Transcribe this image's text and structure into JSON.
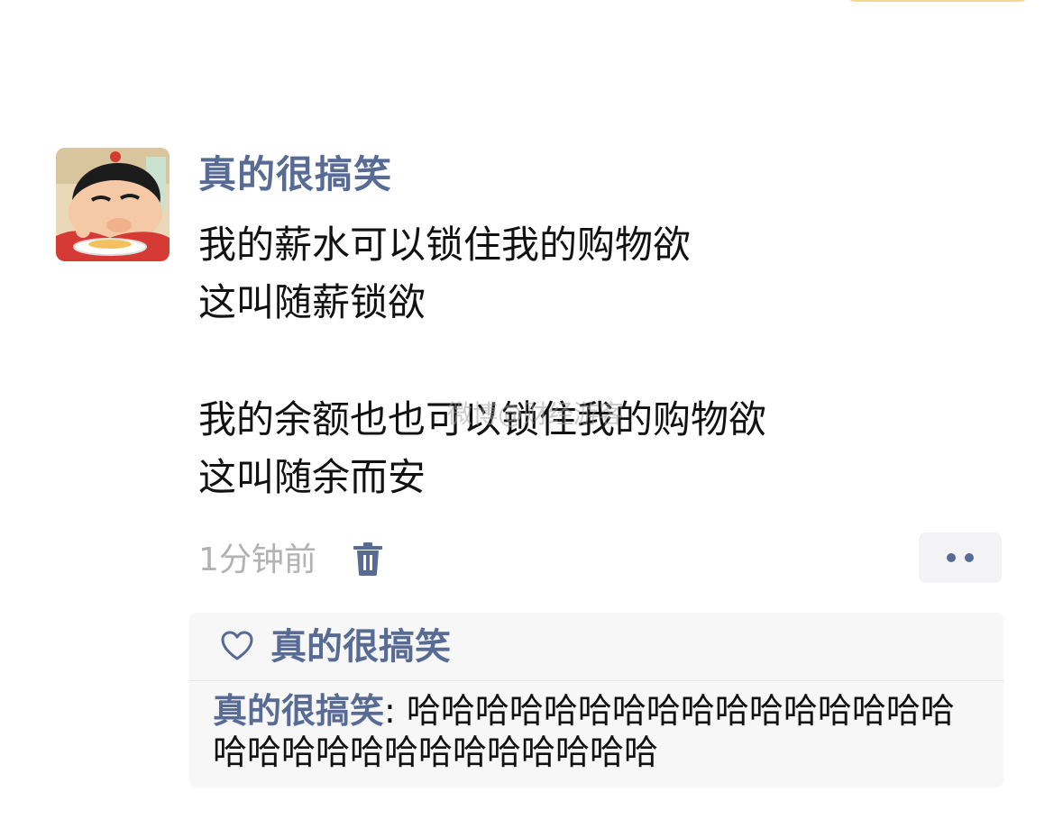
{
  "post": {
    "author": "真的很搞笑",
    "lines": [
      "我的薪水可以锁住我的购物欲",
      "这叫随薪锁欲",
      "",
      "我的余额也也可以锁住我的购物欲",
      "这叫随余而安"
    ],
    "time": "1分钟前"
  },
  "watermark": "微博@财经游客",
  "likes": {
    "names": "真的很搞笑"
  },
  "comments": [
    {
      "author": "真的很搞笑",
      "separator": ": ",
      "text": "哈哈哈哈哈哈哈哈哈哈哈哈哈哈哈哈哈哈哈哈哈哈哈哈哈哈哈哈哈"
    }
  ],
  "icons": {
    "delete": "trash-icon",
    "like": "heart-icon",
    "more": "more-dots-icon"
  },
  "colors": {
    "link": "#576b95",
    "text": "#111111",
    "muted": "#b2b2b2",
    "panel": "#f7f7f7"
  }
}
